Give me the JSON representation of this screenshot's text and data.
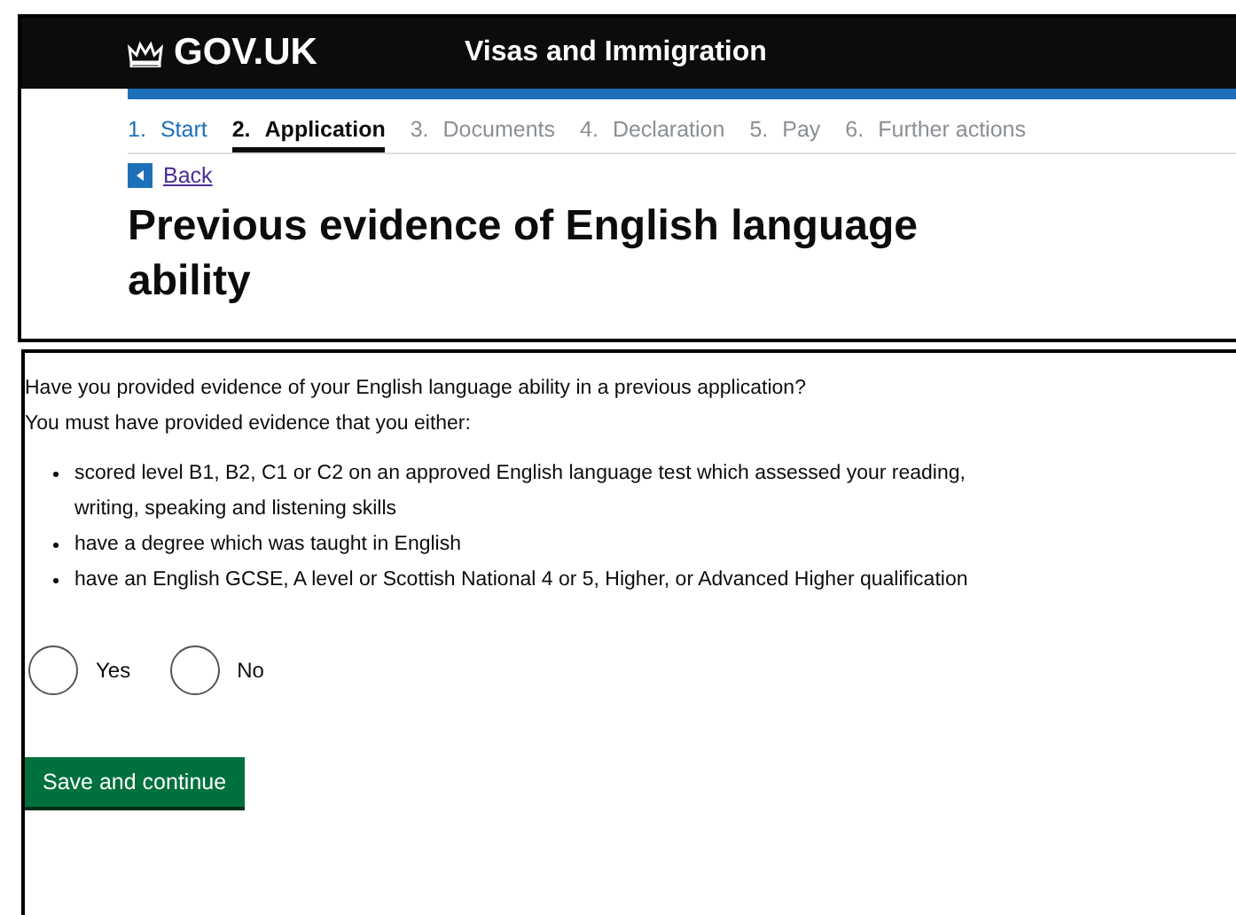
{
  "header": {
    "logo": "GOV.UK",
    "service": "Visas and Immigration"
  },
  "steps": [
    {
      "number": "1.",
      "label": "Start",
      "selected": false,
      "completed": true
    },
    {
      "number": "2.",
      "label": "Application",
      "selected": true,
      "completed": false
    },
    {
      "number": "3.",
      "label": "Documents",
      "selected": false,
      "completed": false
    },
    {
      "number": "4.",
      "label": "Declaration",
      "selected": false,
      "completed": false
    },
    {
      "number": "5.",
      "label": "Pay",
      "selected": false,
      "completed": false
    },
    {
      "number": "6.",
      "label": "Further actions",
      "selected": false,
      "completed": false
    }
  ],
  "back_link": "Back",
  "heading": "Previous evidence of English language ability",
  "question": "Have you provided evidence of your English language ability in a previous application?",
  "hint": "You must have provided evidence that you either:",
  "bullets": [
    "scored level B1, B2, C1 or C2 on an approved English language test which assessed your reading, writing, speaking and listening skills",
    "have a degree which was taught in English",
    "have an English GCSE, A level or Scottish National 4 or 5, Higher, or Advanced Higher qualification"
  ],
  "options": [
    {
      "label": "Yes",
      "selected": false
    },
    {
      "label": "No",
      "selected": false
    }
  ],
  "submit": "Save and continue"
}
